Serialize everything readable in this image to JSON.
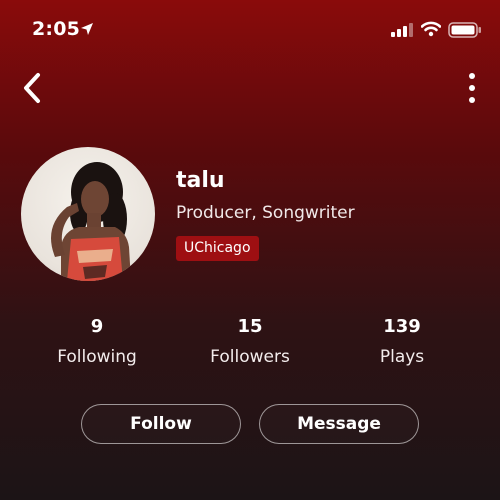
{
  "status_bar": {
    "time": "2:05",
    "icons": [
      "location-arrow-icon",
      "signal-bars-icon",
      "wifi-icon",
      "battery-icon"
    ]
  },
  "nav": {
    "icons": [
      "chevron-left-icon",
      "more-vertical-icon"
    ]
  },
  "profile": {
    "name": "talu",
    "roles": "Producer, Songwriter",
    "school_badge": "UChicago"
  },
  "stats": [
    {
      "value": "9",
      "label": "Following"
    },
    {
      "value": "15",
      "label": "Followers"
    },
    {
      "value": "139",
      "label": "Plays"
    }
  ],
  "actions": {
    "follow_label": "Follow",
    "message_label": "Message"
  },
  "colors": {
    "gradient_top": "#8a0b0b",
    "gradient_bottom": "#1c1416",
    "badge_bg": "#9e0f12",
    "text": "#ffffff"
  }
}
